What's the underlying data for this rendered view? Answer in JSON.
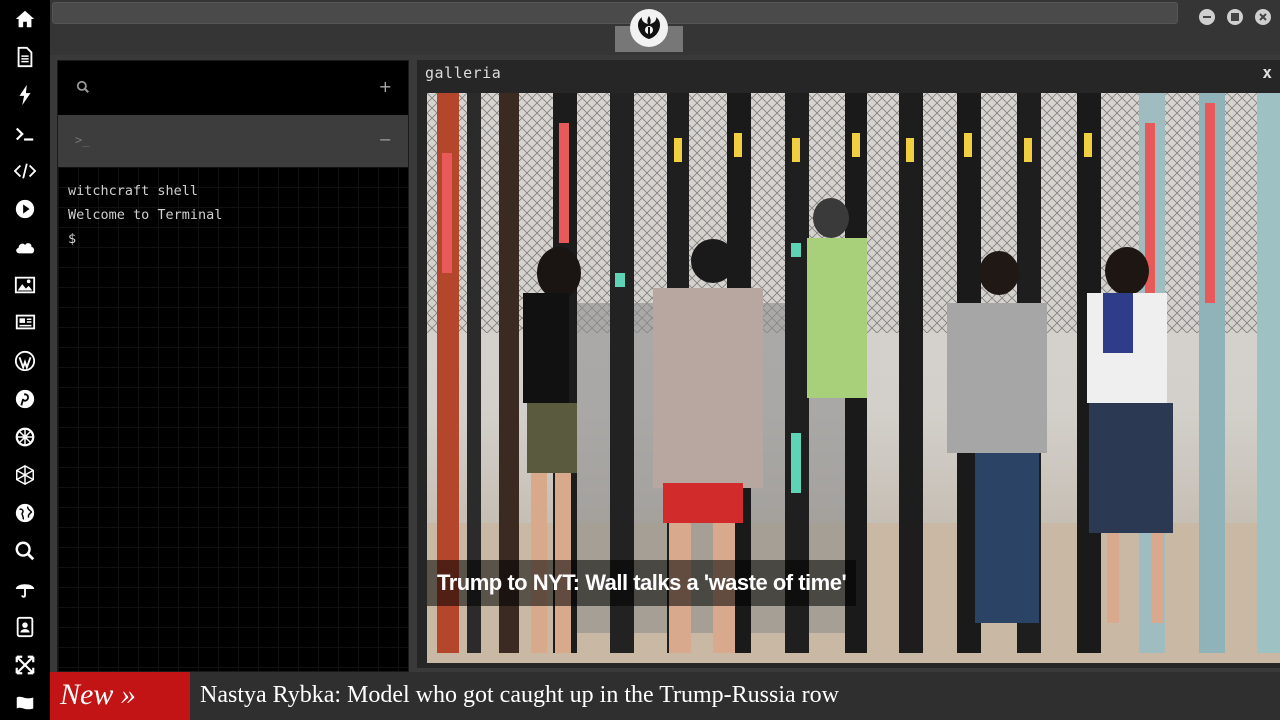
{
  "sidebar": {
    "icons": [
      "home-icon",
      "document-icon",
      "bolt-icon",
      "terminal-icon",
      "code-icon",
      "play-icon",
      "cloud-icon",
      "image-icon",
      "newspaper-icon",
      "wordpress-icon",
      "pinterest-icon",
      "settings-wheel-icon",
      "network-icon",
      "globe-icon",
      "search-icon",
      "umbrella-icon",
      "contacts-icon",
      "expand-icon",
      "flag-icon"
    ]
  },
  "window": {
    "logo": "rebel-alliance-logo-icon",
    "controls": [
      "minimize",
      "maximize",
      "close"
    ]
  },
  "terminal": {
    "search_icon": "search-icon",
    "add_label": "+",
    "tab_prompt": ">_",
    "tab_collapse": "−",
    "lines": [
      "witchcraft shell",
      "Welcome to Terminal",
      "$"
    ]
  },
  "gallery": {
    "title": "galleria",
    "close": "x",
    "caption": "Trump to NYT: Wall talks a 'waste of time'"
  },
  "ticker": {
    "badge": "New »",
    "headline": "Nastya Rybka: Model who got caught up in the Trump-Russia row"
  },
  "colors": {
    "badge": "#c21414",
    "panel_bg": "#000000",
    "frame_bg": "#3a3a3a"
  }
}
